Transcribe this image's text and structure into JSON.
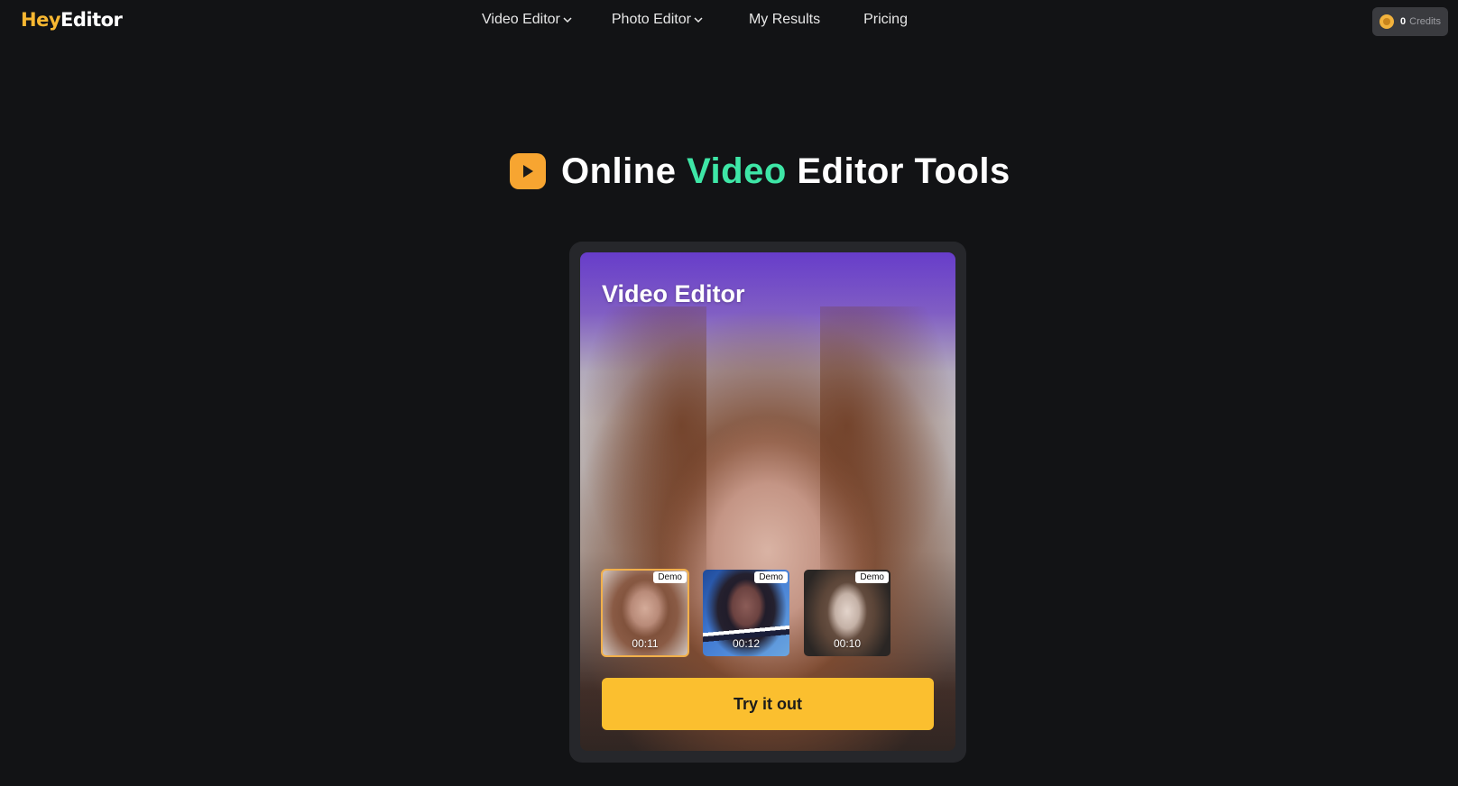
{
  "header": {
    "logo": {
      "part1": "Hey",
      "part2": "Editor"
    },
    "nav": [
      {
        "label": "Video Editor",
        "has_dropdown": true
      },
      {
        "label": "Photo Editor",
        "has_dropdown": true
      },
      {
        "label": "My Results",
        "has_dropdown": false
      },
      {
        "label": "Pricing",
        "has_dropdown": false
      }
    ],
    "credits": {
      "count": "0",
      "label": "Credits",
      "icon": "coin-icon"
    }
  },
  "hero": {
    "title_prefix": "Online ",
    "title_accent": "Video",
    "title_suffix": " Editor Tools",
    "icon": "play-icon"
  },
  "card": {
    "title": "Video Editor",
    "thumbnails": [
      {
        "tag": "Demo",
        "duration": "00:11",
        "selected": true
      },
      {
        "tag": "Demo",
        "duration": "00:12",
        "selected": false
      },
      {
        "tag": "Demo",
        "duration": "00:10",
        "selected": false
      }
    ],
    "cta_label": "Try it out"
  },
  "colors": {
    "background": "#121315",
    "accent_green": "#3ee6a6",
    "brand_orange": "#f7a531",
    "cta_yellow": "#fbbf2f",
    "logo_yellow": "#f7b731"
  }
}
